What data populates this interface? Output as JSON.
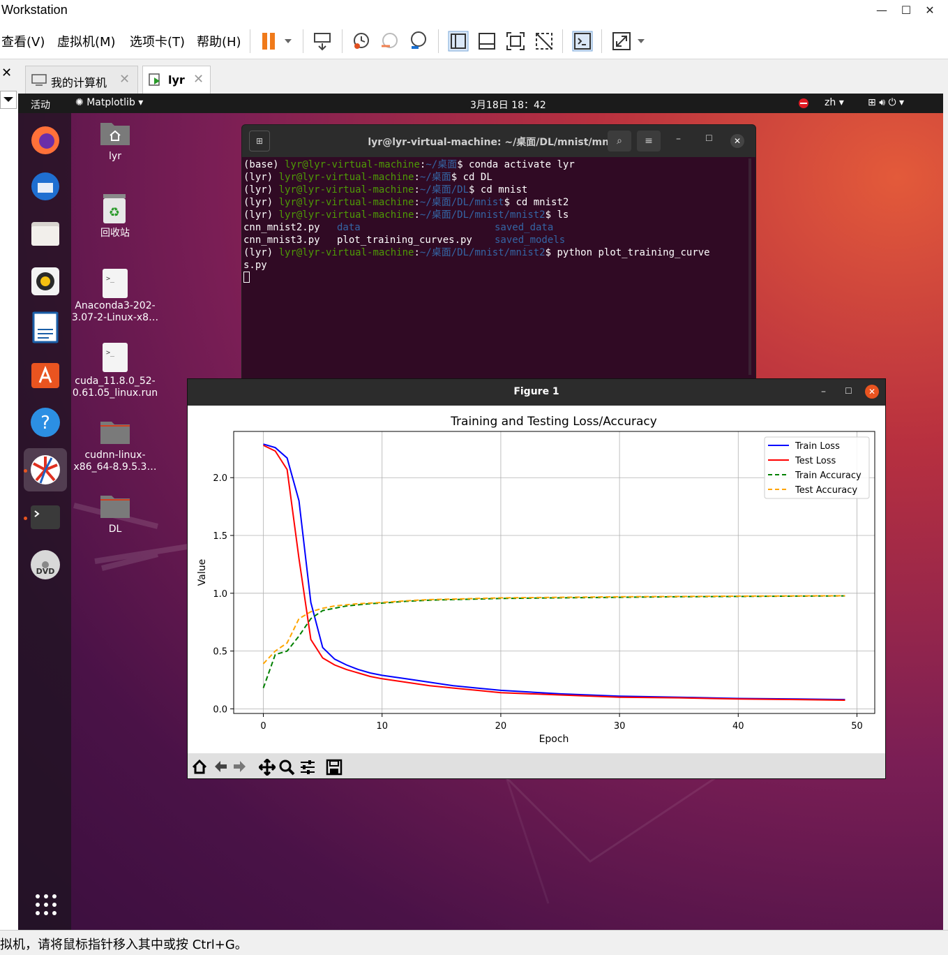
{
  "window": {
    "title": "Workstation"
  },
  "menu": {
    "items": [
      "查看(V)",
      "虚拟机(M)",
      "选项卡(T)",
      "帮助(H)"
    ]
  },
  "tabs": [
    {
      "label": "我的计算机"
    },
    {
      "label": "lyr"
    }
  ],
  "vm_topbar": {
    "activities": "活动",
    "app": "Matplotlib",
    "clock": "3月18日  18：42",
    "lang": "zh"
  },
  "desktop_icons": [
    {
      "label": "lyr"
    },
    {
      "label": "回收站"
    },
    {
      "label": "Anaconda3-202-3.07-2-Linux-x8…"
    },
    {
      "label": "cuda_11.8.0_52-0.61.05_linux.run"
    },
    {
      "label": "cudnn-linux-x86_64-8.9.5.3…"
    },
    {
      "label": "DL"
    }
  ],
  "terminal": {
    "title": "lyr@lyr-virtual-machine: ~/桌面/DL/mnist/mnist2",
    "lines": [
      {
        "pre": "(base) ",
        "user": "lyr@lyr-virtual-machine",
        "path": "~/桌面",
        "cmd": "$ conda activate lyr"
      },
      {
        "pre": "(lyr) ",
        "user": "lyr@lyr-virtual-machine",
        "path": "~/桌面",
        "cmd": "$ cd DL"
      },
      {
        "pre": "(lyr) ",
        "user": "lyr@lyr-virtual-machine",
        "path": "~/桌面/DL",
        "cmd": "$ cd mnist"
      },
      {
        "pre": "(lyr) ",
        "user": "lyr@lyr-virtual-machine",
        "path": "~/桌面/DL/mnist",
        "cmd": "$ cd mnist2"
      },
      {
        "pre": "(lyr) ",
        "user": "lyr@lyr-virtual-machine",
        "path": "~/桌面/DL/mnist/mnist2",
        "cmd": "$ ls"
      }
    ],
    "ls_row1": {
      "a": "cnn_mnist2.py",
      "b": "data",
      "c": "saved_data"
    },
    "ls_row2": {
      "a": "cnn_mnist3.py",
      "b": "plot_training_curves.py",
      "c": "saved_models"
    },
    "last": {
      "pre": "(lyr) ",
      "user": "lyr@lyr-virtual-machine",
      "path": "~/桌面/DL/mnist/mnist2",
      "cmd": "$ python plot_training_curve",
      "wrap": "s.py"
    }
  },
  "figure": {
    "window_title": "Figure 1"
  },
  "chart_data": {
    "type": "line",
    "title": "Training and Testing Loss/Accuracy",
    "xlabel": "Epoch",
    "ylabel": "Value",
    "xlim": [
      -2.5,
      51.5
    ],
    "ylim": [
      -0.04,
      2.4
    ],
    "xticks": [
      0,
      10,
      20,
      30,
      40,
      50
    ],
    "yticks": [
      0.0,
      0.5,
      1.0,
      1.5,
      2.0
    ],
    "ytick_labels": [
      "0.0",
      "0.5",
      "1.0",
      "1.5",
      "2.0"
    ],
    "grid": true,
    "legend_placement": "top-right",
    "x": [
      0,
      1,
      2,
      3,
      4,
      5,
      6,
      7,
      8,
      9,
      10,
      12,
      14,
      16,
      18,
      20,
      25,
      30,
      35,
      40,
      45,
      49
    ],
    "series": [
      {
        "name": "Train Loss",
        "color": "#0000ff",
        "dash": "solid",
        "values": [
          2.29,
          2.26,
          2.17,
          1.8,
          0.92,
          0.53,
          0.43,
          0.38,
          0.34,
          0.31,
          0.29,
          0.26,
          0.23,
          0.2,
          0.18,
          0.16,
          0.13,
          0.11,
          0.1,
          0.09,
          0.085,
          0.08
        ]
      },
      {
        "name": "Test Loss",
        "color": "#ff0000",
        "dash": "solid",
        "values": [
          2.28,
          2.23,
          2.07,
          1.3,
          0.6,
          0.44,
          0.38,
          0.34,
          0.31,
          0.28,
          0.26,
          0.23,
          0.2,
          0.18,
          0.16,
          0.14,
          0.12,
          0.1,
          0.095,
          0.085,
          0.08,
          0.075
        ]
      },
      {
        "name": "Train Accuracy",
        "color": "#008000",
        "dash": "dashed",
        "values": [
          0.18,
          0.47,
          0.5,
          0.63,
          0.78,
          0.85,
          0.87,
          0.89,
          0.9,
          0.91,
          0.915,
          0.93,
          0.94,
          0.945,
          0.95,
          0.955,
          0.96,
          0.965,
          0.97,
          0.972,
          0.975,
          0.977
        ]
      },
      {
        "name": "Test Accuracy",
        "color": "#ffa500",
        "dash": "dashed",
        "values": [
          0.39,
          0.5,
          0.57,
          0.78,
          0.84,
          0.87,
          0.89,
          0.9,
          0.91,
          0.915,
          0.92,
          0.935,
          0.945,
          0.95,
          0.955,
          0.96,
          0.965,
          0.97,
          0.972,
          0.975,
          0.977,
          0.978
        ]
      }
    ]
  },
  "statusbar": {
    "text": "拟机，请将鼠标指针移入其中或按 Ctrl+G。"
  }
}
